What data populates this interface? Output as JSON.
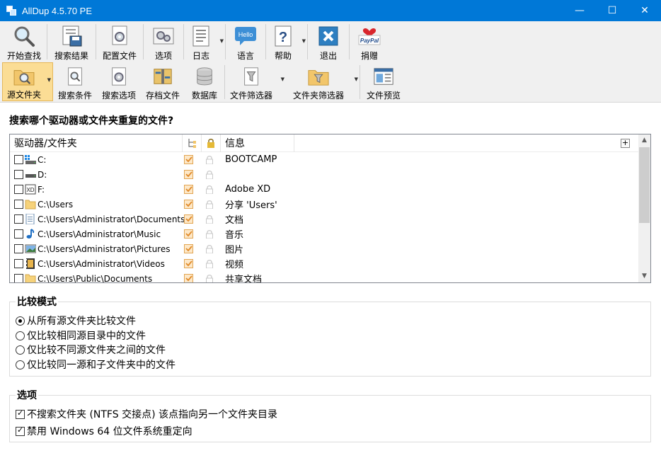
{
  "window": {
    "title": "AllDup 4.5.70 PE",
    "minimize": "—",
    "maximize": "☐",
    "close": "✕"
  },
  "toolbar1": [
    {
      "id": "start-search",
      "label": "开始查找",
      "icon": "magnifier-icon"
    },
    {
      "id": "search-results",
      "label": "搜索结果",
      "icon": "save-results-icon"
    },
    {
      "id": "profiles",
      "label": "配置文件",
      "icon": "profile-gear-icon"
    },
    {
      "id": "options",
      "label": "选项",
      "icon": "options-gear-icon"
    },
    {
      "id": "log",
      "label": "日志",
      "icon": "log-document-icon",
      "dropdown": true
    },
    {
      "id": "language",
      "label": "语言",
      "icon": "hello-bubble-icon",
      "bubble_text": "Hello"
    },
    {
      "id": "help",
      "label": "帮助",
      "icon": "help-question-icon",
      "dropdown": true
    },
    {
      "id": "exit",
      "label": "退出",
      "icon": "exit-x-icon"
    },
    {
      "id": "donate",
      "label": "捐赠",
      "icon": "paypal-icon",
      "brand_text": "PayPal"
    }
  ],
  "toolbar2": [
    {
      "id": "source-folders",
      "label": "源文件夹",
      "icon": "folder-search-icon",
      "dropdown": true,
      "active": true
    },
    {
      "id": "search-criteria",
      "label": "搜索条件",
      "icon": "criteria-doc-icon"
    },
    {
      "id": "search-options",
      "label": "搜索选项",
      "icon": "search-options-icon"
    },
    {
      "id": "archive-files",
      "label": "存档文件",
      "icon": "archive-zip-icon"
    },
    {
      "id": "database",
      "label": "数据库",
      "icon": "database-icon"
    },
    {
      "id": "file-filter",
      "label": "文件筛选器",
      "icon": "file-filter-icon",
      "dropdown": true
    },
    {
      "id": "folder-filter",
      "label": "文件夹筛选器",
      "icon": "folder-filter-icon",
      "dropdown": true
    },
    {
      "id": "file-preview",
      "label": "文件预览",
      "icon": "preview-window-icon"
    }
  ],
  "main": {
    "question": "搜索哪个驱动器或文件夹重复的文件?"
  },
  "drive_list": {
    "columns": {
      "name": "驱动器/文件夹",
      "info": "信息"
    },
    "rows": [
      {
        "path": "C:",
        "info": "BOOTCAMP",
        "icon": "windows-drive-icon"
      },
      {
        "path": "D:",
        "info": "",
        "icon": "drive-icon"
      },
      {
        "path": "F:",
        "info": "Adobe XD",
        "icon": "adobe-drive-icon"
      },
      {
        "path": "C:\\Users",
        "info": "分享 'Users'",
        "icon": "folder-icon"
      },
      {
        "path": "C:\\Users\\Administrator\\Documents",
        "info": "文档",
        "icon": "documents-icon"
      },
      {
        "path": "C:\\Users\\Administrator\\Music",
        "info": "音乐",
        "icon": "music-note-icon"
      },
      {
        "path": "C:\\Users\\Administrator\\Pictures",
        "info": "图片",
        "icon": "pictures-icon"
      },
      {
        "path": "C:\\Users\\Administrator\\Videos",
        "info": "视频",
        "icon": "video-film-icon"
      },
      {
        "path": "C:\\Users\\Public\\Documents",
        "info": "共享文档",
        "icon": "folder-icon"
      }
    ]
  },
  "compare_mode": {
    "title": "比较模式",
    "options": [
      {
        "label": "从所有源文件夹比较文件",
        "selected": true
      },
      {
        "label": "仅比较相同源目录中的文件",
        "selected": false
      },
      {
        "label": "仅比较不同源文件夹之间的文件",
        "selected": false
      },
      {
        "label": "仅比较同一源和子文件夹中的文件",
        "selected": false
      }
    ]
  },
  "options": {
    "title": "选项",
    "items": [
      {
        "label": "不搜索文件夹 (NTFS 交接点) 该点指向另一个文件夹目录",
        "checked": true
      },
      {
        "label": "禁用 Windows 64 位文件系统重定向",
        "checked": true
      }
    ]
  }
}
